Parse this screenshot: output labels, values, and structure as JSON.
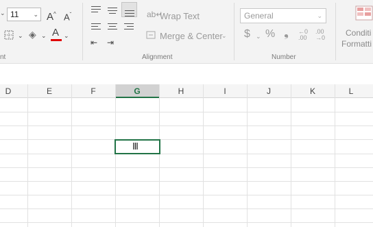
{
  "ribbon": {
    "font": {
      "group_label_partial": "nt",
      "size": "11",
      "increase_font": "A",
      "decrease_font": "A",
      "font_color_letter": "A",
      "font_color": "#e00000"
    },
    "alignment": {
      "group_label": "Alignment",
      "wrap_text": "Wrap Text",
      "merge_center": "Merge & Center"
    },
    "number": {
      "group_label": "Number",
      "format": "General",
      "currency_symbol": "$",
      "percent_symbol": "%",
      "comma_symbol": "❟"
    },
    "styles": {
      "conditional_formatting_line1": "Conditi",
      "conditional_formatting_line2": "Formatti"
    }
  },
  "grid": {
    "columns": [
      "D",
      "E",
      "F",
      "G",
      "H",
      "I",
      "J",
      "K",
      "L"
    ],
    "active_column": "G",
    "accent_color": "#217346"
  }
}
